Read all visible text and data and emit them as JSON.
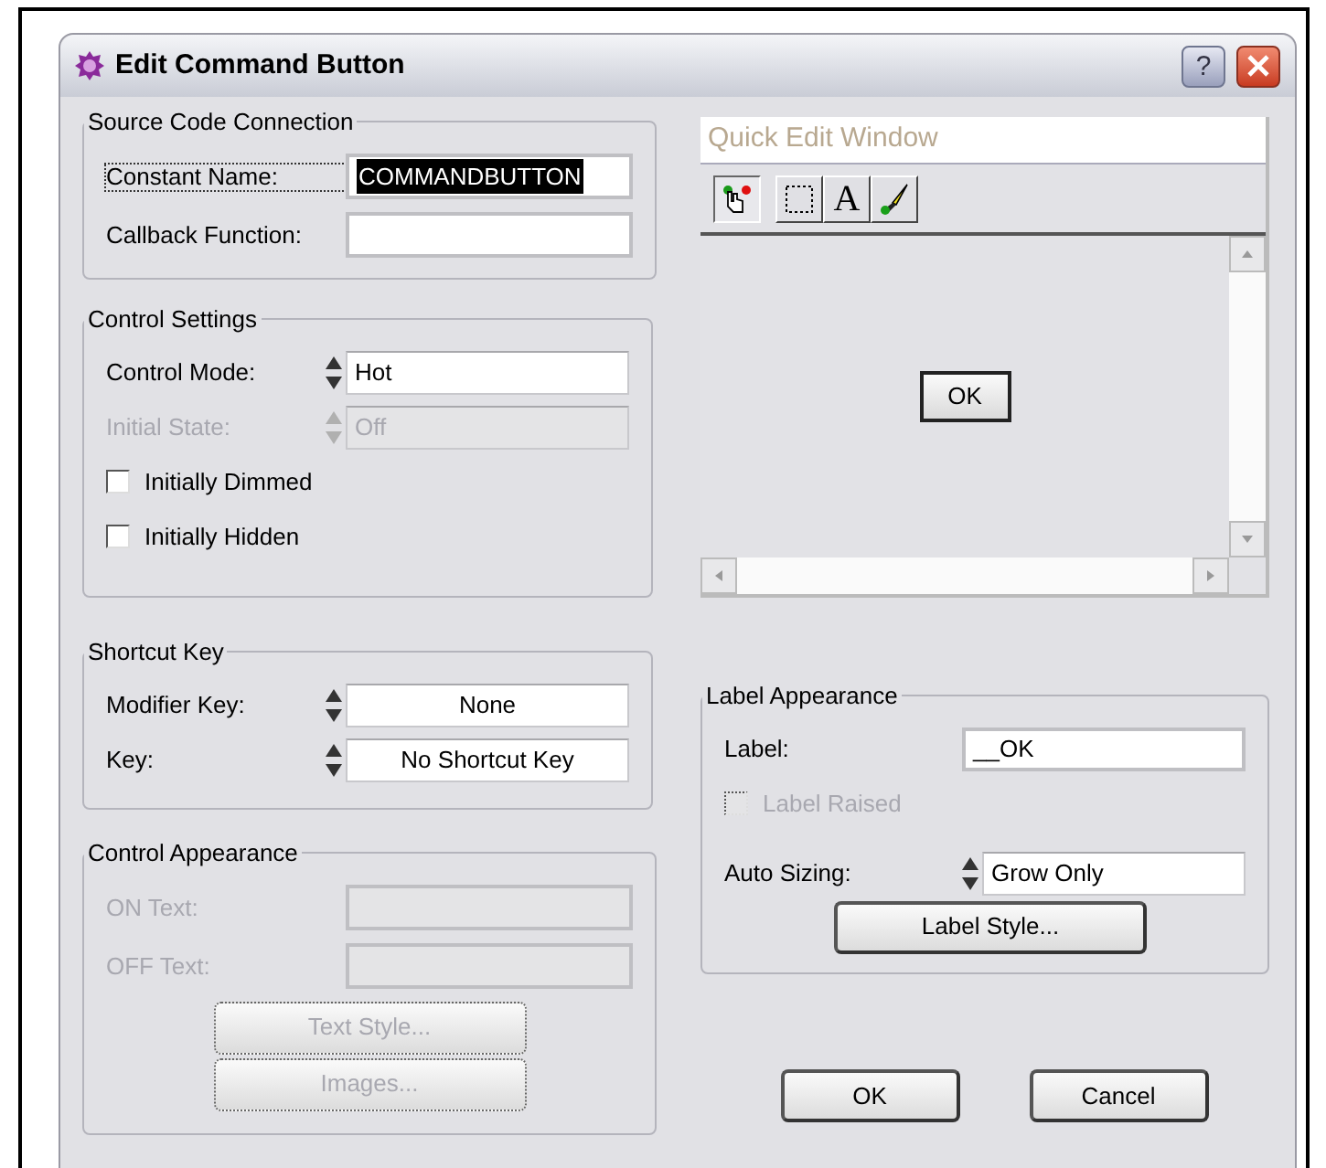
{
  "dialog": {
    "title": "Edit Command Button",
    "help_button": "?"
  },
  "source_code_connection": {
    "title": "Source Code Connection",
    "fields": [
      {
        "label": "Constant Name:",
        "value": "COMMANDBUTTON",
        "focused": true
      },
      {
        "label": "Callback Function:",
        "focused": false
      }
    ]
  },
  "control_settings": {
    "title": "Control Settings",
    "rings": [
      {
        "label": "Control Mode:",
        "value": "Hot",
        "disabled": false
      },
      {
        "label": "Initial State:",
        "value": "Off",
        "disabled": true
      }
    ],
    "checkboxes": [
      {
        "label": "Initially Dimmed",
        "checked": false
      },
      {
        "label": "Initially Hidden",
        "checked": false
      }
    ]
  },
  "shortcut_key": {
    "title": "Shortcut Key",
    "rings": [
      {
        "label": "Modifier Key:",
        "value": "None"
      },
      {
        "label": "Key:",
        "value": "No Shortcut Key"
      }
    ]
  },
  "control_appearance": {
    "title": "Control Appearance",
    "disabled": true,
    "fields": [
      {
        "label": "ON Text:"
      },
      {
        "label": "OFF Text:"
      }
    ],
    "buttons": [
      "Text Style...",
      "Images..."
    ]
  },
  "quick_edit": {
    "title": "Quick Edit Window",
    "tools": [
      {
        "kind": "operate",
        "selected": true
      },
      {
        "kind": "select",
        "selected": false
      },
      {
        "kind": "text",
        "label": "A",
        "selected": false
      },
      {
        "kind": "color",
        "selected": false
      }
    ],
    "preview_button": "OK"
  },
  "label_appearance": {
    "title": "Label Appearance",
    "label_field": {
      "label": "Label:",
      "value": "__OK"
    },
    "raised": {
      "label": "Label Raised",
      "checked": false,
      "disabled": true
    },
    "auto_sizing": {
      "label": "Auto Sizing:",
      "value": "Grow Only"
    },
    "style_button": "Label Style..."
  },
  "buttons": [
    "OK",
    "Cancel"
  ]
}
